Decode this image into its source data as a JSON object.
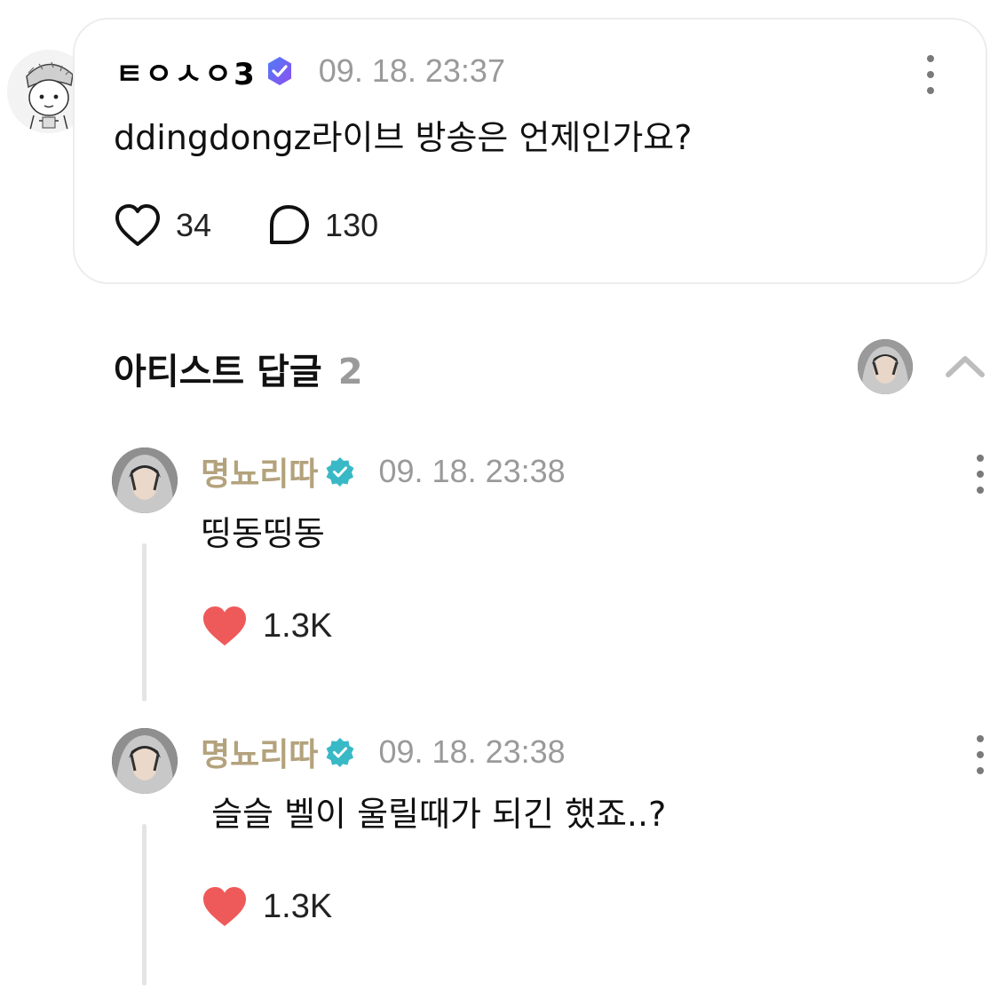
{
  "post": {
    "author": "ㅌㅇㅅㅇ3",
    "timestamp": "09. 18. 23:37",
    "body": "ddingdongz라이브 방송은 언제인가요?",
    "likes": "34",
    "comments": "130",
    "badge_color": "#6b5cf0"
  },
  "replies_section": {
    "title": "아티스트 답글",
    "count": "2"
  },
  "replies": [
    {
      "artist": "명뇨리따",
      "timestamp": "09. 18. 23:38",
      "body": "띵동띵동",
      "likes": "1.3K"
    },
    {
      "artist": "명뇨리따",
      "timestamp": "09. 18. 23:38",
      "body": " 슬슬 벨이 울릴때가 되긴 했죠..?",
      "likes": "1.3K"
    }
  ],
  "colors": {
    "artist_name": "#b3a27c",
    "verified_teal": "#39b9c6",
    "heart_red": "#ee5a5a",
    "timestamp_gray": "#9a9a9a"
  },
  "icons": {
    "post_like": "heart-outline-icon",
    "post_comment": "speech-bubble-icon",
    "reply_like": "heart-filled-icon",
    "collapse": "chevron-up-icon",
    "more": "kebab-menu-icon"
  }
}
